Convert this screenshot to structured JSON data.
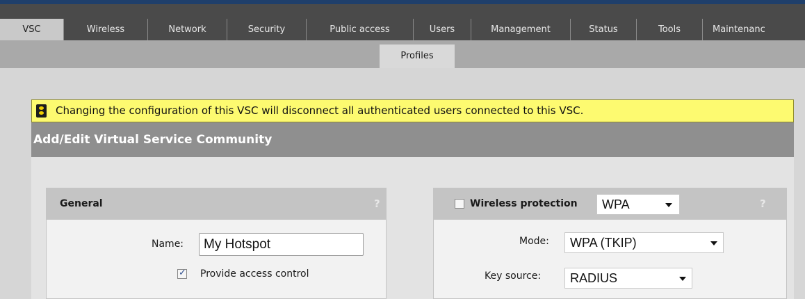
{
  "tabs": [
    {
      "label": "VSC",
      "active": true
    },
    {
      "label": "Wireless",
      "active": false
    },
    {
      "label": "Network",
      "active": false
    },
    {
      "label": "Security",
      "active": false
    },
    {
      "label": "Public access",
      "active": false
    },
    {
      "label": "Users",
      "active": false
    },
    {
      "label": "Management",
      "active": false
    },
    {
      "label": "Status",
      "active": false
    },
    {
      "label": "Tools",
      "active": false
    },
    {
      "label": "Maintenanc",
      "active": false
    }
  ],
  "subtabs": [
    {
      "label": "Profiles",
      "active": true
    }
  ],
  "warning": {
    "text": "Changing the configuration of this VSC will disconnect all authenticated users connected to this VSC."
  },
  "panel": {
    "title": "Add/Edit Virtual Service Community"
  },
  "general": {
    "title": "General",
    "help": "?",
    "name_label": "Name:",
    "name_value": "My Hotspot",
    "access_control_label": "Provide access control",
    "access_control_checked": true
  },
  "wireless": {
    "protection_label": "Wireless protection",
    "protection_checked": false,
    "protection_value": "WPA",
    "help": "?",
    "mode_label": "Mode:",
    "mode_value": "WPA (TKIP)",
    "key_source_label": "Key source:",
    "key_source_value": "RADIUS"
  },
  "colors": {
    "header": "#4a4a4a",
    "warning": "#fdfa70",
    "panel_header": "#8f8f8f"
  }
}
